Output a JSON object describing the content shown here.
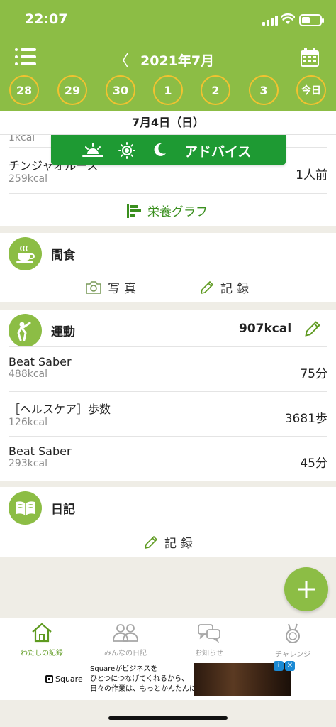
{
  "status": {
    "time": "22:07"
  },
  "header": {
    "month": "2021年7月",
    "prev_icon": "chevron-left-icon",
    "menu_icon": "list-menu-icon",
    "calendar_icon": "calendar-icon",
    "days": [
      "28",
      "29",
      "30",
      "1",
      "2",
      "3",
      "今日"
    ]
  },
  "date_bar": {
    "label": "7月4日（日）"
  },
  "advice": {
    "label": "アドバイス",
    "icons": [
      "sunrise-icon",
      "sun-icon",
      "moon-icon"
    ]
  },
  "meal_partial": {
    "cut_kcal": "1kcal",
    "item": {
      "name": "チンジャオルース",
      "kcal": "259kcal",
      "qty": "1人前"
    },
    "graph_label": "栄養グラフ"
  },
  "snack": {
    "title": "間食",
    "photo_label": "写真",
    "record_label": "記録"
  },
  "exercise": {
    "title": "運動",
    "total": "907kcal",
    "items": [
      {
        "name": "Beat Saber",
        "kcal": "488kcal",
        "value": "75分"
      },
      {
        "name": "［ヘルスケア］歩数",
        "kcal": "126kcal",
        "value": "3681歩"
      },
      {
        "name": "Beat Saber",
        "kcal": "293kcal",
        "value": "45分"
      }
    ]
  },
  "diary": {
    "title": "日記",
    "record_label": "記録"
  },
  "tabs": [
    {
      "label": "わたしの記録",
      "icon": "home-icon",
      "active": true
    },
    {
      "label": "みんなの日記",
      "icon": "people-icon",
      "active": false
    },
    {
      "label": "お知らせ",
      "icon": "chat-bubbles-icon",
      "active": false
    },
    {
      "label": "チャレンジ",
      "icon": "medal-icon",
      "active": false
    }
  ],
  "ad": {
    "brand": "Square",
    "line1": "Squareがビジネスを",
    "line2": "ひとつにつなげてくれるから、",
    "line3": "日々の作業は、もっとかんたんに。"
  },
  "colors": {
    "brand_green": "#8cbd45",
    "advice_green": "#1e9a33",
    "ring_yellow": "#f2c230"
  }
}
